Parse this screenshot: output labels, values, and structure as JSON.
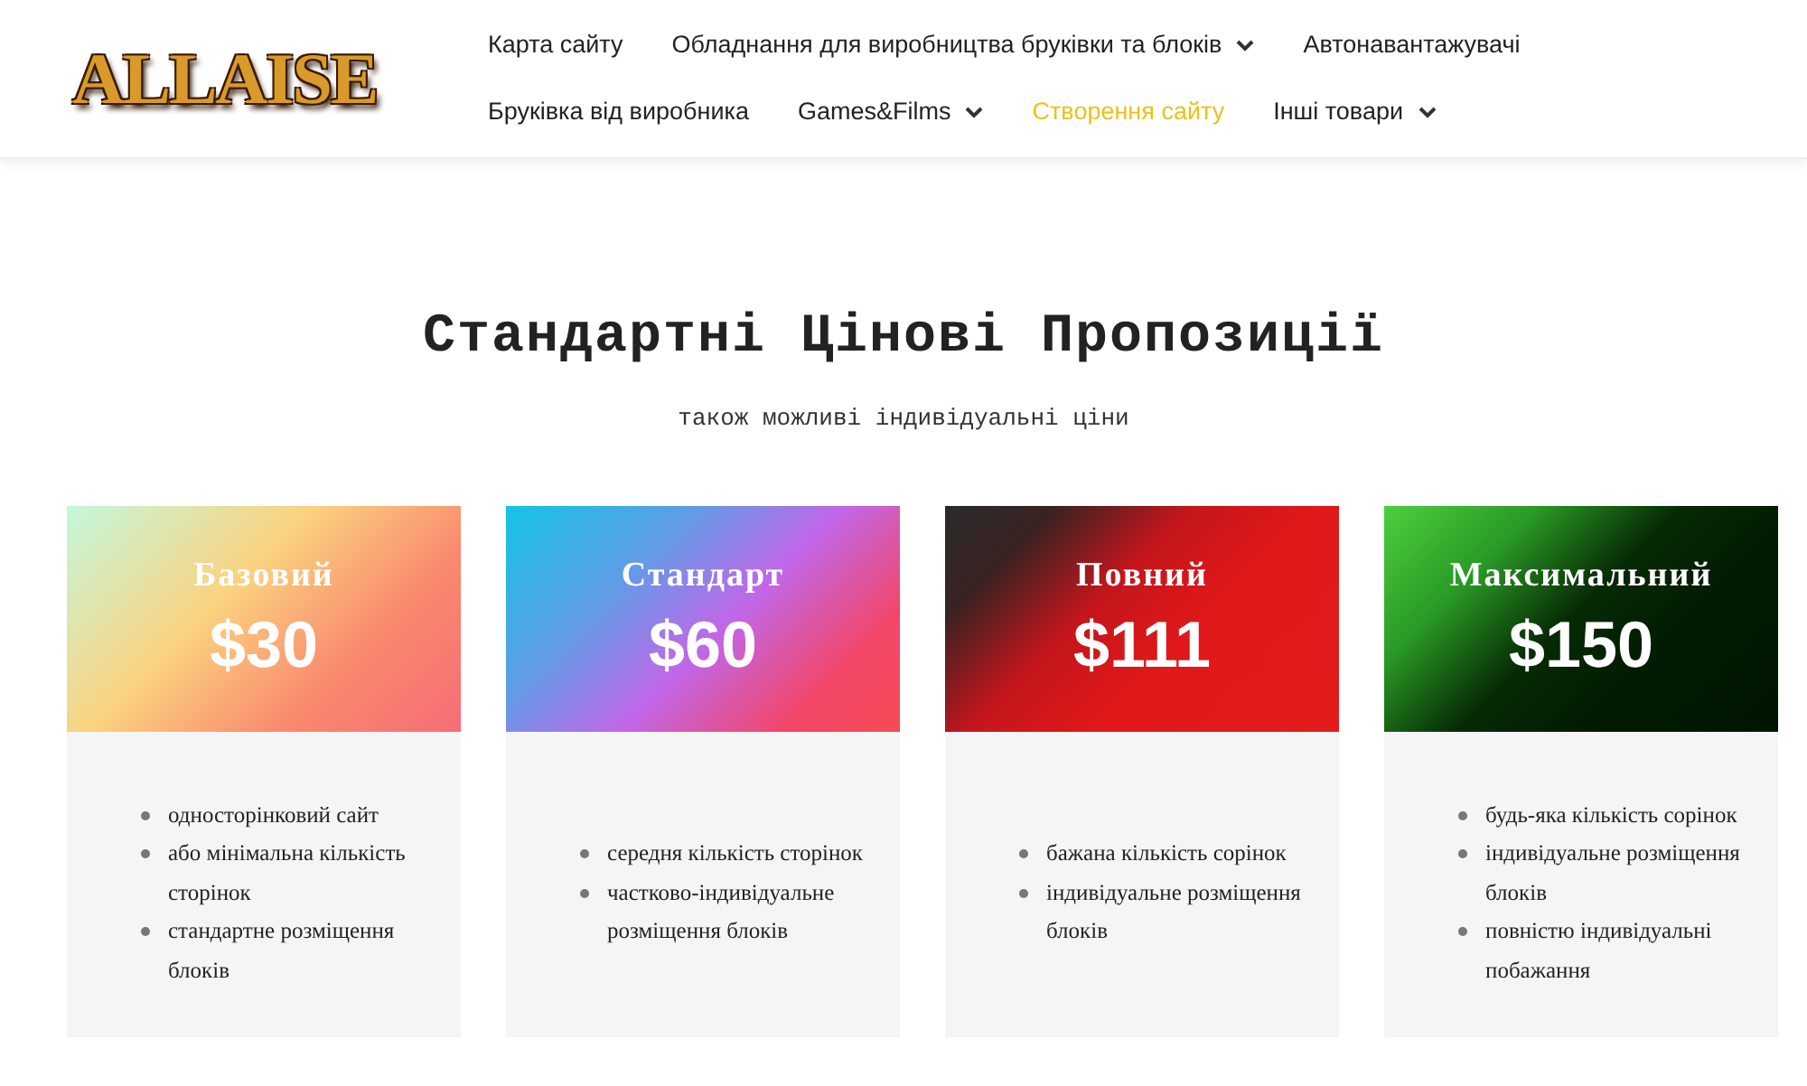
{
  "logo": {
    "text": "ALLAISE"
  },
  "nav": [
    [
      {
        "label": "Карта сайту",
        "dropdown": false,
        "selected": false
      },
      {
        "label": "Обладнання для виробництва бруківки та блоків",
        "dropdown": true,
        "selected": false
      },
      {
        "label": "Автонавантажувачі",
        "dropdown": false,
        "selected": false
      }
    ],
    [
      {
        "label": "Бруківка від виробника",
        "dropdown": false,
        "selected": false
      },
      {
        "label": "Games&Films",
        "dropdown": true,
        "selected": false
      },
      {
        "label": "Створення сайту",
        "dropdown": false,
        "selected": true
      },
      {
        "label": "Інші товари",
        "dropdown": true,
        "selected": false
      }
    ]
  ],
  "heading": "Стандартні Цінові Пропозиції",
  "subheading": "також можливі індивідуальні ціни",
  "plans": [
    {
      "kind": "pastel",
      "name": "Базовий",
      "price": "$30",
      "features": [
        "односторінковий сайт",
        "або мінімальна кількість сторінок",
        "стандартне розміщення блоків"
      ]
    },
    {
      "kind": "rainbow",
      "name": "Стандарт",
      "price": "$60",
      "features": [
        "середня кількість сторінок",
        "частково-індивідуальне розміщення блоків"
      ]
    },
    {
      "kind": "red",
      "name": "Повний",
      "price": "$111",
      "features": [
        "бажана кількість сорінок",
        "індивідуальне розміщення блоків"
      ]
    },
    {
      "kind": "green",
      "name": "Максимальний",
      "price": "$150",
      "features": [
        "будь-яка кількість сорінок",
        "індивідуальне розміщення блоків",
        "повністю індивідуальні побажання"
      ]
    }
  ]
}
